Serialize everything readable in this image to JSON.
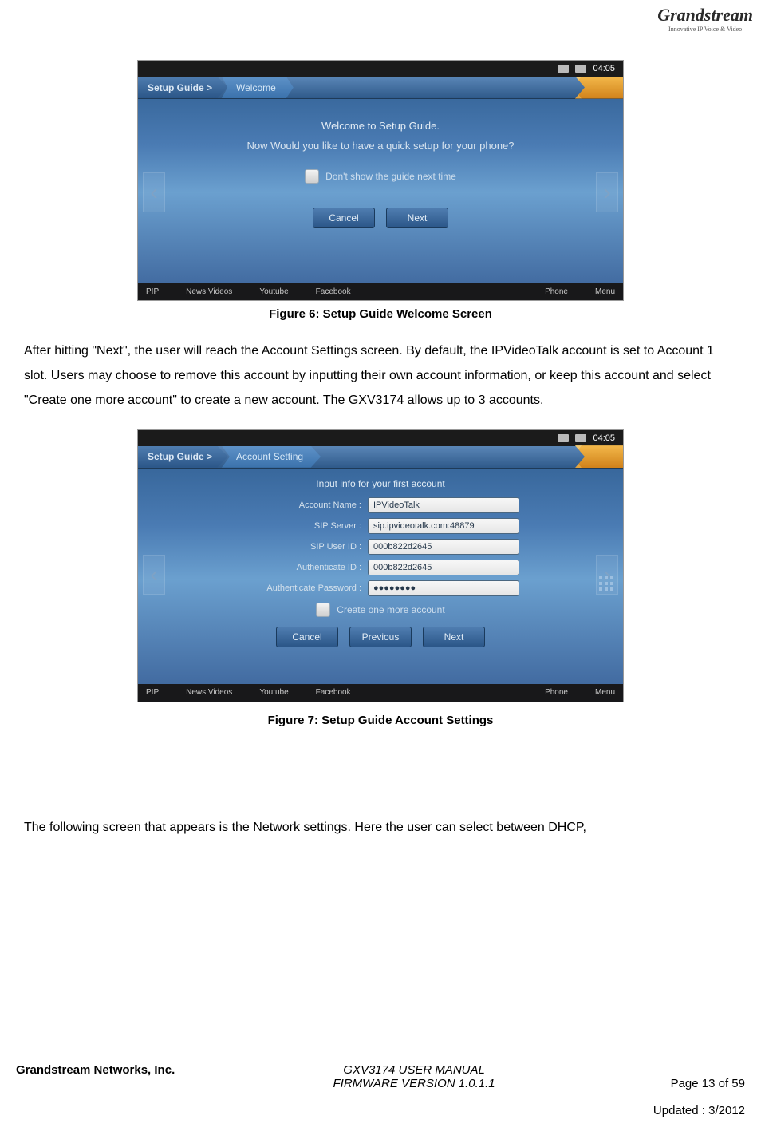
{
  "logo": {
    "brand": "Grandstream",
    "tagline": "Innovative IP Voice & Video"
  },
  "fig6": {
    "time": "04:05",
    "breadcrumb_root": "Setup Guide >",
    "breadcrumb_current": "Welcome",
    "title": "Welcome to Setup Guide.",
    "subtitle": "Now Would you like to have a quick setup for your phone?",
    "checkbox_label": "Don't show the guide next time",
    "btn_cancel": "Cancel",
    "btn_next": "Next",
    "bottombar": [
      "PIP",
      "News Videos",
      "Youtube",
      "Facebook",
      "Phone",
      "Menu"
    ],
    "caption": "Figure 6: Setup Guide Welcome Screen"
  },
  "para1": "After hitting \"Next\", the user will reach the Account Settings screen. By default, the IPVideoTalk account is set to Account 1 slot.   Users may choose to remove this account by inputting their own account information, or keep this account and select \"Create one more account\" to create a new account.   The GXV3174 allows up to 3 accounts.",
  "fig7": {
    "time": "04:05",
    "breadcrumb_root": "Setup Guide >",
    "breadcrumb_current": "Account Setting",
    "form_title": "Input info for your first account",
    "fields": {
      "account_name": {
        "label": "Account Name :",
        "value": "IPVideoTalk"
      },
      "sip_server": {
        "label": "SIP Server :",
        "value": "sip.ipvideotalk.com:48879"
      },
      "sip_user": {
        "label": "SIP User ID :",
        "value": "000b822d2645"
      },
      "auth_id": {
        "label": "Authenticate ID :",
        "value": "000b822d2645"
      },
      "auth_pw": {
        "label": "Authenticate Password :",
        "value": "●●●●●●●●"
      }
    },
    "checkbox_label": "Create one more account",
    "btn_cancel": "Cancel",
    "btn_prev": "Previous",
    "btn_next": "Next",
    "bottombar": [
      "PIP",
      "News Videos",
      "Youtube",
      "Facebook",
      "Phone",
      "Menu"
    ],
    "caption": "Figure 7: Setup Guide Account Settings"
  },
  "para2": "The following screen that appears is the Network settings.   Here the user can select between DHCP,",
  "footer": {
    "left": "Grandstream Networks, Inc.",
    "mid1": "GXV3174 USER MANUAL",
    "mid2": "FIRMWARE VERSION 1.0.1.1",
    "right1": "Page 13 of 59",
    "right2": "Updated : 3/2012"
  }
}
